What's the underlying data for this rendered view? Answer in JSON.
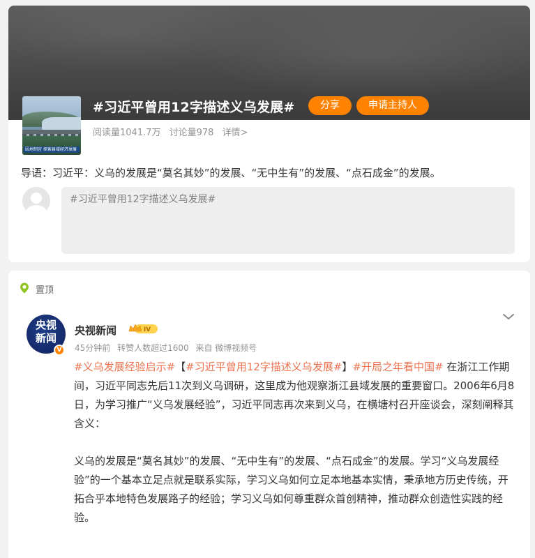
{
  "topic": {
    "title": "#习近平曾用12字描述义乌发展#",
    "share_label": "分享",
    "host_label": "申请主持人",
    "thumb_caption": "因地制宜 探索县域经济发展",
    "stats": {
      "reads": "阅读量1041.7万",
      "discussions": "讨论量978",
      "details": "详情>"
    },
    "intro": "导语：习近平：义乌的发展是“莫名其妙”的发展、“无中生有”的发展、“点石成金”的发展。",
    "composer_placeholder": "#习近平曾用12字描述义乌发展#"
  },
  "post": {
    "pinned_label": "置顶",
    "avatar_text_line1": "央视",
    "avatar_text_line2": "新闻",
    "verify_mark": "V",
    "author": "央视新闻",
    "meta": {
      "time": "45分钟前",
      "reposts": "转赞人数超过1600",
      "source": "来自 微博视频号"
    },
    "tags": {
      "t1": "#义乌发展经验启示#",
      "bracket_open": "【",
      "t2": "#习近平曾用12字描述义乌发展#",
      "bracket_close": "】",
      "t3": "#开局之年看中国#"
    },
    "line1_rest": " 在浙江工作期间，习近平同志先后11次到义乌调研，这里成为他观察浙江县域发展的重要窗口。2006年6月8日，为学习推广“义乌发展经验”，习近平同志再次来到义乌，在横塘村召开座谈会，深刻阐释其含义：",
    "paragraph2": "义乌的发展是“莫名其妙”的发展、“无中生有”的发展、“点石成金”的发展。学习“义乌发展经验”的一个基本立足点就是联系实际，学习义乌如何立足本地基本实情，秉承地方历史传统，开拓合乎本地特色发展路子的经验；学习义乌如何尊重群众首创精神，推动群众创造性实践的经验。"
  },
  "colors": {
    "accent": "#ff8200",
    "tag": "#eb7350",
    "meta": "#939393"
  }
}
